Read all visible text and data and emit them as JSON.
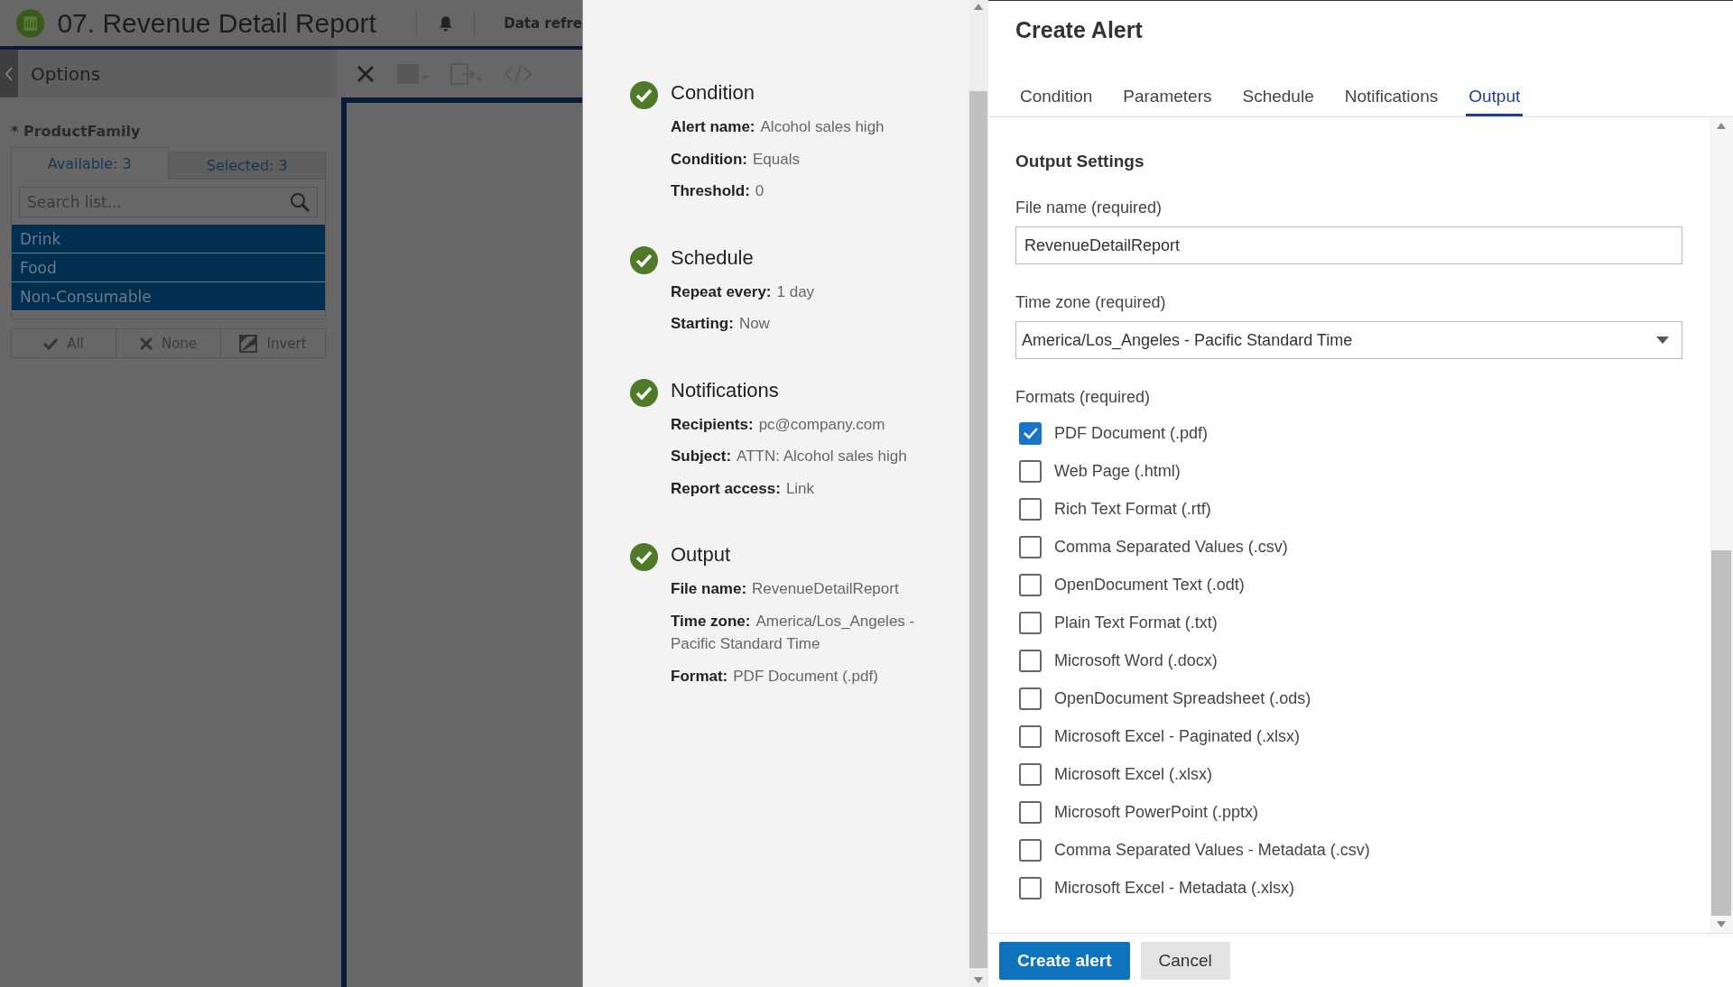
{
  "app": {
    "title": "07. Revenue Detail Report",
    "data_refresh": "Data refre"
  },
  "options": {
    "title": "Options",
    "parameter": "* ProductFamily",
    "tabs": [
      {
        "label": "Available: 3",
        "selected": true
      },
      {
        "label": "Selected: 3",
        "selected": false
      }
    ],
    "search": {
      "placeholder": "Search list..."
    },
    "items": [
      {
        "label": "Drink",
        "selected": true
      },
      {
        "label": "Food",
        "selected": true
      },
      {
        "label": "Non-Consumable",
        "selected": true
      }
    ],
    "actions": [
      {
        "kind": "check",
        "label": "All"
      },
      {
        "kind": "cross",
        "label": "None"
      },
      {
        "kind": "invert",
        "label": "Invert"
      }
    ]
  },
  "summary": [
    {
      "title": "Condition",
      "complete": true,
      "fields": [
        {
          "label": "Alert name:",
          "value": "Alcohol sales high"
        },
        {
          "label": "Condition:",
          "value": "Equals"
        },
        {
          "label": "Threshold:",
          "value": "0"
        }
      ]
    },
    {
      "title": "Schedule",
      "complete": true,
      "fields": [
        {
          "label": "Repeat every:",
          "value": "1 day"
        },
        {
          "label": "Starting:",
          "value": "Now"
        }
      ]
    },
    {
      "title": "Notifications",
      "complete": true,
      "fields": [
        {
          "label": "Recipients:",
          "value": "pc@company.com"
        },
        {
          "label": "Subject:",
          "value": "ATTN: Alcohol sales high"
        },
        {
          "label": "Report access:",
          "value": "Link"
        }
      ]
    },
    {
      "title": "Output",
      "complete": true,
      "fields": [
        {
          "label": "File name:",
          "value": "RevenueDetailReport"
        },
        {
          "label": "Time zone:",
          "value": "America/Los_Angeles - Pacific Standard Time"
        },
        {
          "label": "Format:",
          "value": "PDF Document (.pdf)"
        }
      ]
    }
  ],
  "dialog": {
    "title": "Create Alert",
    "tabs": [
      {
        "label": "Condition",
        "selected": false
      },
      {
        "label": "Parameters",
        "selected": false
      },
      {
        "label": "Schedule",
        "selected": false
      },
      {
        "label": "Notifications",
        "selected": false
      },
      {
        "label": "Output",
        "selected": true
      }
    ],
    "section_title": "Output Settings",
    "file_name": {
      "label": "File name (required)",
      "value": "RevenueDetailReport"
    },
    "time_zone": {
      "label": "Time zone (required)",
      "value": "America/Los_Angeles - Pacific Standard Time"
    },
    "formats_label": "Formats (required)",
    "formats": [
      {
        "label": "PDF Document (.pdf)",
        "checked": true
      },
      {
        "label": "Web Page (.html)",
        "checked": false
      },
      {
        "label": "Rich Text Format (.rtf)",
        "checked": false
      },
      {
        "label": "Comma Separated Values (.csv)",
        "checked": false
      },
      {
        "label": "OpenDocument Text (.odt)",
        "checked": false
      },
      {
        "label": "Plain Text Format (.txt)",
        "checked": false
      },
      {
        "label": "Microsoft Word (.docx)",
        "checked": false
      },
      {
        "label": "OpenDocument Spreadsheet (.ods)",
        "checked": false
      },
      {
        "label": "Microsoft Excel - Paginated (.xlsx)",
        "checked": false
      },
      {
        "label": "Microsoft Excel (.xlsx)",
        "checked": false
      },
      {
        "label": "Microsoft PowerPoint (.pptx)",
        "checked": false
      },
      {
        "label": "Comma Separated Values - Metadata (.csv)",
        "checked": false
      },
      {
        "label": "Microsoft Excel - Metadata (.xlsx)",
        "checked": false
      }
    ],
    "buttons": [
      {
        "kind": "primary",
        "label": "Create alert"
      },
      {
        "kind": "secondary",
        "label": "Cancel"
      }
    ]
  }
}
